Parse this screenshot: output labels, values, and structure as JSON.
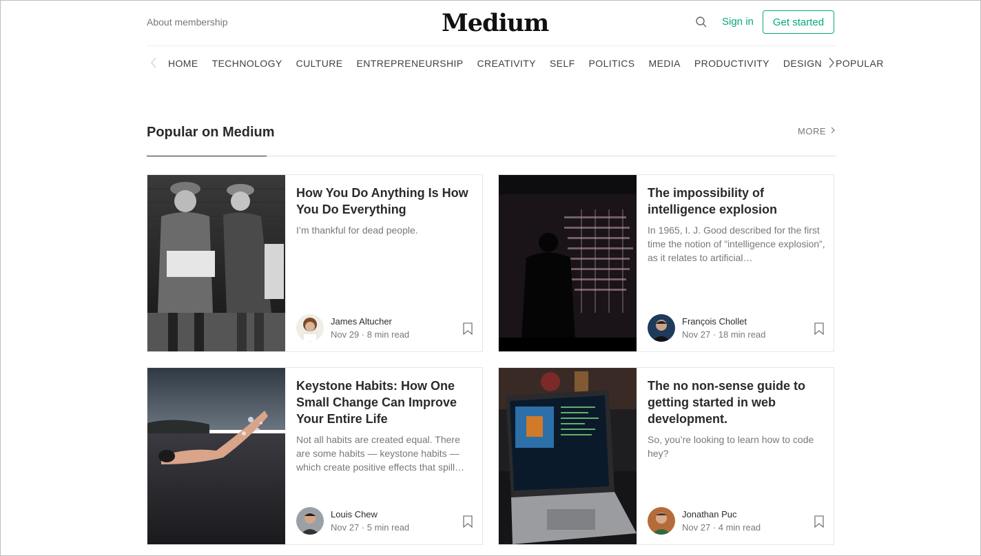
{
  "header": {
    "about_label": "About membership",
    "logo": "Medium",
    "signin_label": "Sign in",
    "get_started_label": "Get started"
  },
  "nav": {
    "items": [
      "HOME",
      "TECHNOLOGY",
      "CULTURE",
      "ENTREPRENEURSHIP",
      "CREATIVITY",
      "SELF",
      "POLITICS",
      "MEDIA",
      "PRODUCTIVITY",
      "DESIGN",
      "POPULAR"
    ]
  },
  "section": {
    "title": "Popular on Medium",
    "more_label": "MORE"
  },
  "colors": {
    "accent": "#03a87c"
  },
  "cards": [
    {
      "title": "How You Do Anything Is How You Do Everything",
      "subtitle": "I’m thankful for dead people.",
      "author": "James Altucher",
      "meta": "Nov 29 · 8 min read"
    },
    {
      "title": "The impossibility of intelligence explosion",
      "subtitle": "In 1965, I. J. Good described for the first time the notion of ”intelligence explosion”, as it relates to artificial…",
      "author": "François Chollet",
      "meta": "Nov 27 · 18 min read"
    },
    {
      "title": "Keystone Habits: How One Small Change Can Improve Your Entire Life",
      "subtitle": "Not all habits are created equal. There are some habits — keystone habits — which create positive effects that spill…",
      "author": "Louis Chew",
      "meta": "Nov 27 · 5 min read"
    },
    {
      "title": "The no non-sense guide to getting started in web development.",
      "subtitle": "So, you’re looking to learn how to code hey?",
      "author": "Jonathan Puc",
      "meta": "Nov 27 · 4 min read"
    }
  ]
}
